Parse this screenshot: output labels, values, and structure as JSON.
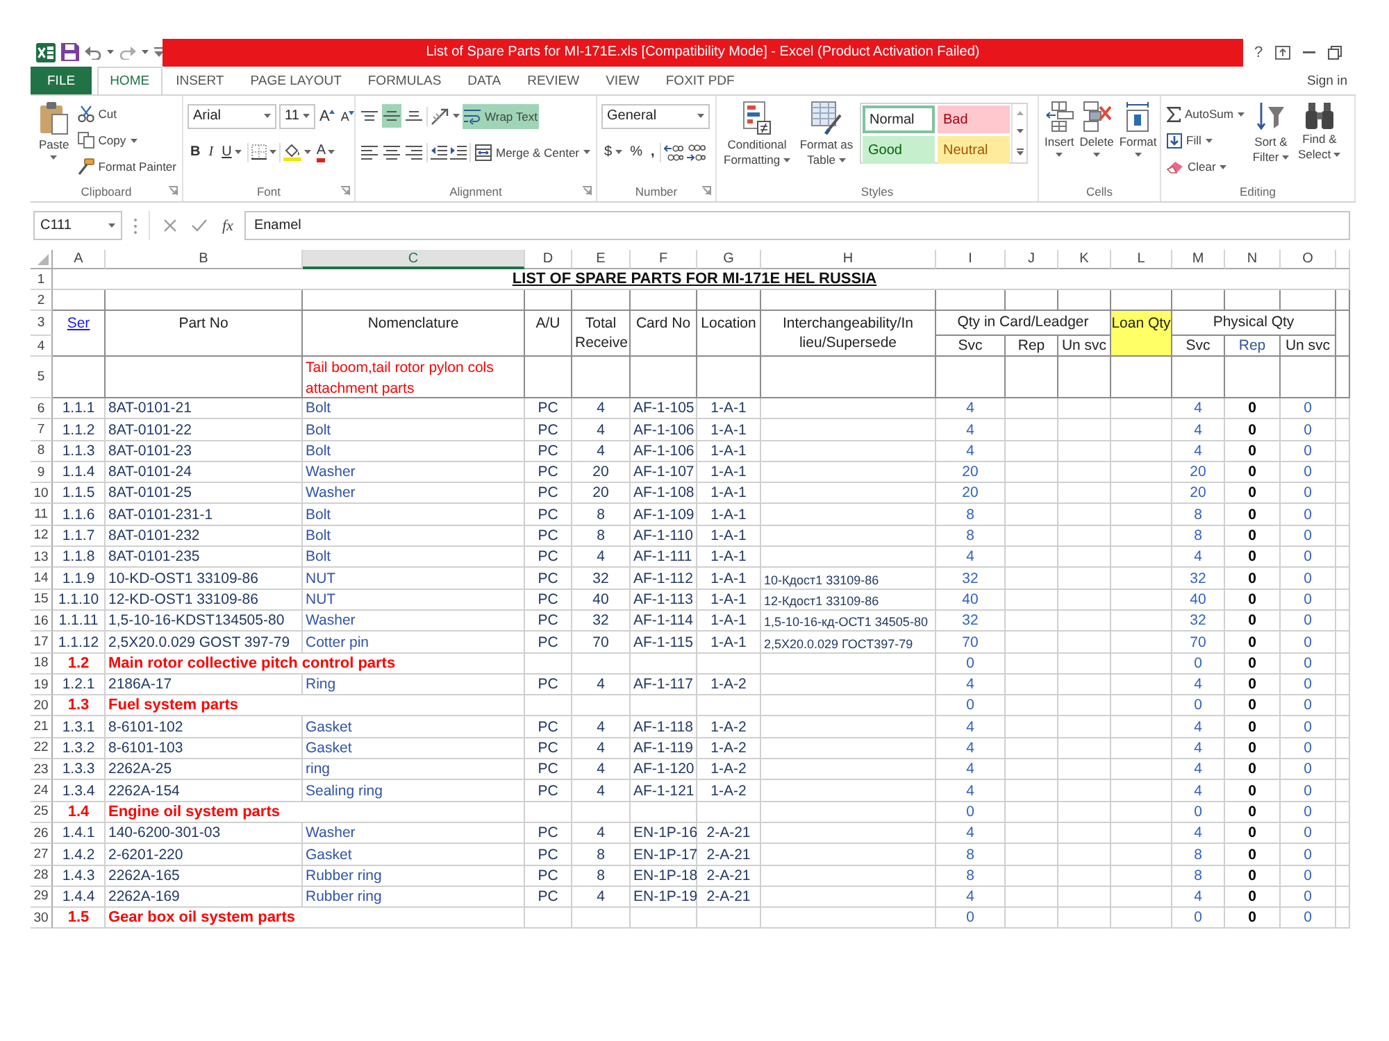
{
  "window": {
    "title": "List of Spare Parts for MI-171E.xls  [Compatibility Mode] -  Excel (Product Activation Failed)",
    "help": "?"
  },
  "ribbon_tabs": [
    {
      "label": "FILE",
      "kind": "file",
      "selected": false
    },
    {
      "label": "HOME",
      "kind": "tab",
      "selected": true
    },
    {
      "label": "INSERT",
      "kind": "tab",
      "selected": false
    },
    {
      "label": "PAGE LAYOUT",
      "kind": "tab",
      "selected": false
    },
    {
      "label": "FORMULAS",
      "kind": "tab",
      "selected": false
    },
    {
      "label": "DATA",
      "kind": "tab",
      "selected": false
    },
    {
      "label": "REVIEW",
      "kind": "tab",
      "selected": false
    },
    {
      "label": "VIEW",
      "kind": "tab",
      "selected": false
    },
    {
      "label": "FOXIT PDF",
      "kind": "tab",
      "selected": false
    }
  ],
  "account": {
    "sign_in": "Sign in"
  },
  "ribbon": {
    "groups": [
      {
        "kind": "clipboard",
        "label": "Clipboard",
        "launcher": true,
        "paste": "Paste",
        "cut": "Cut",
        "copy": "Copy",
        "format_painter": "Format Painter"
      },
      {
        "kind": "font",
        "label": "Font",
        "launcher": true,
        "font_name": "Arial",
        "font_size": "11",
        "grow_font": "A",
        "shrink_font": "A",
        "bold": "B",
        "italic": "I",
        "underline": "U",
        "font_color": "A"
      },
      {
        "kind": "alignment",
        "label": "Alignment",
        "launcher": true,
        "vertical_align": [
          {
            "selected": false
          },
          {
            "selected": true
          },
          {
            "selected": false
          }
        ],
        "horizontal_align": [
          {
            "selected": false
          },
          {
            "selected": false
          },
          {
            "selected": false
          }
        ],
        "wrap_text": {
          "label": "Wrap Text",
          "on": true
        },
        "merge": "Merge & Center"
      },
      {
        "kind": "number",
        "label": "Number",
        "launcher": true,
        "format": "General",
        "currency": "$",
        "percent": "%",
        "comma": ","
      },
      {
        "kind": "styles",
        "label": "Styles",
        "launcher": false,
        "conditional_formatting": "Conditional Formatting",
        "format_as_table": "Format as Table",
        "cell_styles": [
          {
            "label": "Normal",
            "kind": "normal",
            "selected": true
          },
          {
            "label": "Bad",
            "kind": "bad",
            "selected": false
          },
          {
            "label": "Good",
            "kind": "good",
            "selected": false
          },
          {
            "label": "Neutral",
            "kind": "neutral",
            "selected": false
          }
        ]
      },
      {
        "kind": "cells",
        "label": "Cells",
        "launcher": false,
        "buttons": [
          {
            "label": "Insert",
            "kind": "insert"
          },
          {
            "label": "Delete",
            "kind": "delete"
          },
          {
            "label": "Format",
            "kind": "format"
          }
        ]
      },
      {
        "kind": "editing",
        "label": "Editing",
        "launcher": false,
        "autosum": "AutoSum",
        "fill": "Fill",
        "clear": "Clear",
        "sort_filter": "Sort & Filter",
        "find_select": "Find & Select"
      }
    ]
  },
  "formula_bar": {
    "name_box": "C111",
    "function_button": "fx",
    "formula": "Enamel"
  },
  "sheet": {
    "columns": [
      {
        "label": "A",
        "selected": false
      },
      {
        "label": "B",
        "selected": false
      },
      {
        "label": "C",
        "selected": true
      },
      {
        "label": "D",
        "selected": false
      },
      {
        "label": "E",
        "selected": false
      },
      {
        "label": "F",
        "selected": false
      },
      {
        "label": "G",
        "selected": false
      },
      {
        "label": "H",
        "selected": false
      },
      {
        "label": "I",
        "selected": false
      },
      {
        "label": "J",
        "selected": false
      },
      {
        "label": "K",
        "selected": false
      },
      {
        "label": "L",
        "selected": false
      },
      {
        "label": "M",
        "selected": false
      },
      {
        "label": "N",
        "selected": false
      },
      {
        "label": "O",
        "selected": false
      }
    ],
    "rows": [
      {
        "number": "1",
        "kind": "title",
        "heading": "LIST OF SPARE PARTS FOR MI-171E HEL RUSSIA"
      },
      {
        "number": "2",
        "kind": "blank"
      },
      {
        "kind": "header",
        "numbers": [
          "3",
          "4"
        ],
        "ser": "Ser",
        "part_no": "Part No",
        "nomenclature": "Nomenclature",
        "au": "A/U",
        "total": "Total Receive",
        "card_no": "Card No",
        "location": "Location",
        "interchange": "Interchangeability/In lieu/Supersede",
        "qty_group": "Qty in Card/Leadger",
        "loan": "Loan Qty",
        "phys_group": "Physical Qty",
        "qty_sub": [
          "Svc",
          "Rep",
          "Un svc"
        ],
        "phys_sub": [
          "Svc",
          "Rep",
          "Un svc"
        ]
      },
      {
        "number": "5",
        "kind": "group",
        "nomenclature": "Tail boom,tail rotor pylon cols attachment parts"
      },
      {
        "number": "6",
        "kind": "item",
        "ser": "1.1.1",
        "part_no": "8AT-0101-21",
        "nomenclature": "Bolt",
        "au": "PC",
        "total": "4",
        "card_no": "AF-1-105",
        "location": "1-A-1",
        "qty_svc": "4",
        "phys_svc": "4",
        "phys_rep": "0",
        "phys_unsvc": "0"
      },
      {
        "number": "7",
        "kind": "item",
        "ser": "1.1.2",
        "part_no": "8AT-0101-22",
        "nomenclature": "Bolt",
        "au": "PC",
        "total": "4",
        "card_no": "AF-1-106",
        "location": "1-A-1",
        "qty_svc": "4",
        "phys_svc": "4",
        "phys_rep": "0",
        "phys_unsvc": "0"
      },
      {
        "number": "8",
        "kind": "item",
        "ser": "1.1.3",
        "part_no": "8AT-0101-23",
        "nomenclature": "Bolt",
        "au": "PC",
        "total": "4",
        "card_no": "AF-1-106",
        "location": "1-A-1",
        "qty_svc": "4",
        "phys_svc": "4",
        "phys_rep": "0",
        "phys_unsvc": "0"
      },
      {
        "number": "9",
        "kind": "item",
        "ser": "1.1.4",
        "part_no": "8AT-0101-24",
        "nomenclature": "Washer",
        "au": "PC",
        "total": "20",
        "card_no": "AF-1-107",
        "location": "1-A-1",
        "qty_svc": "20",
        "phys_svc": "20",
        "phys_rep": "0",
        "phys_unsvc": "0"
      },
      {
        "number": "10",
        "kind": "item",
        "ser": "1.1.5",
        "part_no": "8AT-0101-25",
        "nomenclature": "Washer",
        "au": "PC",
        "total": "20",
        "card_no": "AF-1-108",
        "location": "1-A-1",
        "qty_svc": "20",
        "phys_svc": "20",
        "phys_rep": "0",
        "phys_unsvc": "0"
      },
      {
        "number": "11",
        "kind": "item",
        "ser": "1.1.6",
        "part_no": "8AT-0101-231-1",
        "nomenclature": "Bolt",
        "au": "PC",
        "total": "8",
        "card_no": "AF-1-109",
        "location": "1-A-1",
        "qty_svc": "8",
        "phys_svc": "8",
        "phys_rep": "0",
        "phys_unsvc": "0"
      },
      {
        "number": "12",
        "kind": "item",
        "ser": "1.1.7",
        "part_no": "8AT-0101-232",
        "nomenclature": "Bolt",
        "au": "PC",
        "total": "8",
        "card_no": "AF-1-110",
        "location": "1-A-1",
        "qty_svc": "8",
        "phys_svc": "8",
        "phys_rep": "0",
        "phys_unsvc": "0"
      },
      {
        "number": "13",
        "kind": "item",
        "ser": "1.1.8",
        "part_no": "8AT-0101-235",
        "nomenclature": "Bolt",
        "au": "PC",
        "total": "4",
        "card_no": "AF-1-111",
        "location": "1-A-1",
        "qty_svc": "4",
        "phys_svc": "4",
        "phys_rep": "0",
        "phys_unsvc": "0"
      },
      {
        "number": "14",
        "kind": "item",
        "ser": "1.1.9",
        "part_no": "10-KD-OST1 33109-86",
        "nomenclature": "NUT",
        "au": "PC",
        "total": "32",
        "card_no": "AF-1-112",
        "location": "1-A-1",
        "interchange": "10-Кдост1 33109-86",
        "qty_svc": "32",
        "phys_svc": "32",
        "phys_rep": "0",
        "phys_unsvc": "0"
      },
      {
        "number": "15",
        "kind": "item",
        "ser": "1.1.10",
        "part_no": "12-KD-OST1 33109-86",
        "nomenclature": "NUT",
        "au": "PC",
        "total": "40",
        "card_no": "AF-1-113",
        "location": "1-A-1",
        "interchange": "12-Кдост1 33109-86",
        "qty_svc": "40",
        "phys_svc": "40",
        "phys_rep": "0",
        "phys_unsvc": "0"
      },
      {
        "number": "16",
        "kind": "item",
        "ser": "1.1.11",
        "part_no": "1,5-10-16-KDST134505-80",
        "nomenclature": "Washer",
        "au": "PC",
        "total": "32",
        "card_no": "AF-1-114",
        "location": "1-A-1",
        "interchange": "1,5-10-16-кд-ОСТ1 34505-80",
        "qty_svc": "32",
        "phys_svc": "32",
        "phys_rep": "0",
        "phys_unsvc": "0"
      },
      {
        "number": "17",
        "kind": "item",
        "ser": "1.1.12",
        "part_no": "2,5X20.0.029 GOST 397-79",
        "nomenclature": "Cotter pin",
        "au": "PC",
        "total": "70",
        "card_no": "AF-1-115",
        "location": "1-A-1",
        "interchange": "2,5X20.0.029 ГОСТ397-79",
        "qty_svc": "70",
        "phys_svc": "70",
        "phys_rep": "0",
        "phys_unsvc": "0"
      },
      {
        "number": "18",
        "kind": "section",
        "ser": "1.2",
        "title": "Main rotor collective pitch control parts",
        "qty_svc": "0",
        "phys_svc": "0",
        "phys_rep": "0",
        "phys_unsvc": "0"
      },
      {
        "number": "19",
        "kind": "item",
        "ser": "1.2.1",
        "part_no": "2186A-17",
        "nomenclature": "Ring",
        "au": "PC",
        "total": "4",
        "card_no": "AF-1-117",
        "location": "1-A-2",
        "qty_svc": "4",
        "phys_svc": "4",
        "phys_rep": "0",
        "phys_unsvc": "0"
      },
      {
        "number": "20",
        "kind": "section",
        "ser": "1.3",
        "title": "Fuel system parts",
        "qty_svc": "0",
        "phys_svc": "0",
        "phys_rep": "0",
        "phys_unsvc": "0"
      },
      {
        "number": "21",
        "kind": "item",
        "ser": "1.3.1",
        "part_no": "8-6101-102",
        "nomenclature": "Gasket",
        "au": "PC",
        "total": "4",
        "card_no": "AF-1-118",
        "location": "1-A-2",
        "qty_svc": "4",
        "phys_svc": "4",
        "phys_rep": "0",
        "phys_unsvc": "0"
      },
      {
        "number": "22",
        "kind": "item",
        "ser": "1.3.2",
        "part_no": "8-6101-103",
        "nomenclature": "Gasket",
        "au": "PC",
        "total": "4",
        "card_no": "AF-1-119",
        "location": "1-A-2",
        "qty_svc": "4",
        "phys_svc": "4",
        "phys_rep": "0",
        "phys_unsvc": "0"
      },
      {
        "number": "23",
        "kind": "item",
        "ser": "1.3.3",
        "part_no": "2262A-25",
        "nomenclature": "ring",
        "au": "PC",
        "total": "4",
        "card_no": "AF-1-120",
        "location": "1-A-2",
        "qty_svc": "4",
        "phys_svc": "4",
        "phys_rep": "0",
        "phys_unsvc": "0"
      },
      {
        "number": "24",
        "kind": "item",
        "ser": "1.3.4",
        "part_no": "2262A-154",
        "nomenclature": "Sealing ring",
        "au": "PC",
        "total": "4",
        "card_no": "AF-1-121",
        "location": "1-A-2",
        "qty_svc": "4",
        "phys_svc": "4",
        "phys_rep": "0",
        "phys_unsvc": "0"
      },
      {
        "number": "25",
        "kind": "section",
        "ser": "1.4",
        "title": "Engine oil system parts",
        "qty_svc": "0",
        "phys_svc": "0",
        "phys_rep": "0",
        "phys_unsvc": "0"
      },
      {
        "number": "26",
        "kind": "item",
        "ser": "1.4.1",
        "part_no": "140-6200-301-03",
        "nomenclature": "Washer",
        "au": "PC",
        "total": "4",
        "card_no": "EN-1P-16",
        "location": "2-A-21",
        "qty_svc": "4",
        "phys_svc": "4",
        "phys_rep": "0",
        "phys_unsvc": "0"
      },
      {
        "number": "27",
        "kind": "item",
        "ser": "1.4.2",
        "part_no": "2-6201-220",
        "nomenclature": "Gasket",
        "au": "PC",
        "total": "8",
        "card_no": "EN-1P-17",
        "location": "2-A-21",
        "qty_svc": "8",
        "phys_svc": "8",
        "phys_rep": "0",
        "phys_unsvc": "0"
      },
      {
        "number": "28",
        "kind": "item",
        "ser": "1.4.3",
        "part_no": "2262A-165",
        "nomenclature": "Rubber ring",
        "au": "PC",
        "total": "8",
        "card_no": "EN-1P-18",
        "location": "2-A-21",
        "qty_svc": "8",
        "phys_svc": "8",
        "phys_rep": "0",
        "phys_unsvc": "0"
      },
      {
        "number": "29",
        "kind": "item",
        "ser": "1.4.4",
        "part_no": "2262A-169",
        "nomenclature": "Rubber ring",
        "au": "PC",
        "total": "4",
        "card_no": "EN-1P-19",
        "location": "2-A-21",
        "qty_svc": "4",
        "phys_svc": "4",
        "phys_rep": "0",
        "phys_unsvc": "0"
      },
      {
        "number": "30",
        "kind": "section",
        "ser": "1.5",
        "title": "Gear box oil system parts",
        "qty_svc": "0",
        "phys_svc": "0",
        "phys_rep": "0",
        "phys_unsvc": "0"
      }
    ]
  }
}
